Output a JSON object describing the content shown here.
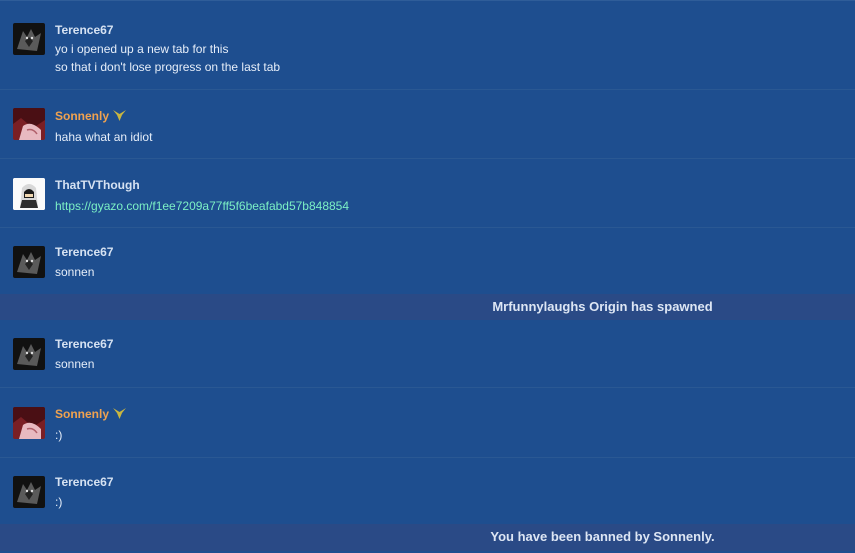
{
  "messages": [
    {
      "user": "Terence67",
      "role": "user",
      "avatar": "dark-wolf-avatar",
      "lines": [
        "yo i opened up a new tab for this",
        "so that i don't lose progress on the last tab"
      ]
    },
    {
      "user": "Sonnenly",
      "role": "moderator",
      "avatar": "red-anime-avatar",
      "badge": "moderator-badge-icon",
      "lines": [
        "haha what an idiot"
      ]
    },
    {
      "user": "ThatTVThough",
      "role": "user",
      "avatar": "white-hood-avatar",
      "link": "https://gyazo.com/f1ee7209a77ff5f6beafabd57b848854"
    },
    {
      "user": "Terence67",
      "role": "user",
      "avatar": "dark-wolf-avatar",
      "lines": [
        "sonnen"
      ]
    },
    {
      "user": "Terence67",
      "role": "user",
      "avatar": "dark-wolf-avatar",
      "lines": [
        "sonnen"
      ]
    },
    {
      "user": "Sonnenly",
      "role": "moderator",
      "avatar": "red-anime-avatar",
      "badge": "moderator-badge-icon",
      "lines": [
        ":)"
      ]
    },
    {
      "user": "Terence67",
      "role": "user",
      "avatar": "dark-wolf-avatar",
      "lines": [
        ":)"
      ]
    }
  ],
  "system": {
    "spawn": "Mrfunnylaughs Origin has spawned",
    "ban": "You have been banned by Sonnenly."
  },
  "colors": {
    "background": "#1e4e8f",
    "system_bar": "#2a4a86",
    "moderator_name": "#f0a24f",
    "link": "#7cf0c5"
  }
}
